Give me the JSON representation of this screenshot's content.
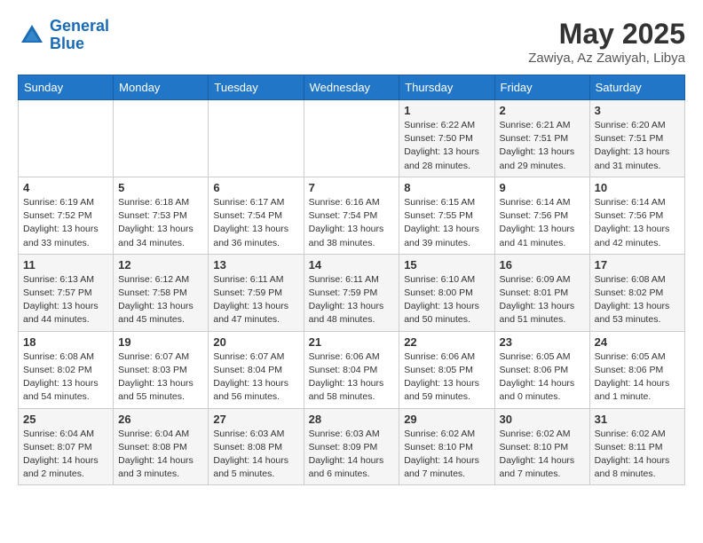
{
  "header": {
    "logo_line1": "General",
    "logo_line2": "Blue",
    "month_title": "May 2025",
    "location": "Zawiya, Az Zawiyah, Libya"
  },
  "weekdays": [
    "Sunday",
    "Monday",
    "Tuesday",
    "Wednesday",
    "Thursday",
    "Friday",
    "Saturday"
  ],
  "weeks": [
    [
      {
        "day": "",
        "info": ""
      },
      {
        "day": "",
        "info": ""
      },
      {
        "day": "",
        "info": ""
      },
      {
        "day": "",
        "info": ""
      },
      {
        "day": "1",
        "info": "Sunrise: 6:22 AM\nSunset: 7:50 PM\nDaylight: 13 hours\nand 28 minutes."
      },
      {
        "day": "2",
        "info": "Sunrise: 6:21 AM\nSunset: 7:51 PM\nDaylight: 13 hours\nand 29 minutes."
      },
      {
        "day": "3",
        "info": "Sunrise: 6:20 AM\nSunset: 7:51 PM\nDaylight: 13 hours\nand 31 minutes."
      }
    ],
    [
      {
        "day": "4",
        "info": "Sunrise: 6:19 AM\nSunset: 7:52 PM\nDaylight: 13 hours\nand 33 minutes."
      },
      {
        "day": "5",
        "info": "Sunrise: 6:18 AM\nSunset: 7:53 PM\nDaylight: 13 hours\nand 34 minutes."
      },
      {
        "day": "6",
        "info": "Sunrise: 6:17 AM\nSunset: 7:54 PM\nDaylight: 13 hours\nand 36 minutes."
      },
      {
        "day": "7",
        "info": "Sunrise: 6:16 AM\nSunset: 7:54 PM\nDaylight: 13 hours\nand 38 minutes."
      },
      {
        "day": "8",
        "info": "Sunrise: 6:15 AM\nSunset: 7:55 PM\nDaylight: 13 hours\nand 39 minutes."
      },
      {
        "day": "9",
        "info": "Sunrise: 6:14 AM\nSunset: 7:56 PM\nDaylight: 13 hours\nand 41 minutes."
      },
      {
        "day": "10",
        "info": "Sunrise: 6:14 AM\nSunset: 7:56 PM\nDaylight: 13 hours\nand 42 minutes."
      }
    ],
    [
      {
        "day": "11",
        "info": "Sunrise: 6:13 AM\nSunset: 7:57 PM\nDaylight: 13 hours\nand 44 minutes."
      },
      {
        "day": "12",
        "info": "Sunrise: 6:12 AM\nSunset: 7:58 PM\nDaylight: 13 hours\nand 45 minutes."
      },
      {
        "day": "13",
        "info": "Sunrise: 6:11 AM\nSunset: 7:59 PM\nDaylight: 13 hours\nand 47 minutes."
      },
      {
        "day": "14",
        "info": "Sunrise: 6:11 AM\nSunset: 7:59 PM\nDaylight: 13 hours\nand 48 minutes."
      },
      {
        "day": "15",
        "info": "Sunrise: 6:10 AM\nSunset: 8:00 PM\nDaylight: 13 hours\nand 50 minutes."
      },
      {
        "day": "16",
        "info": "Sunrise: 6:09 AM\nSunset: 8:01 PM\nDaylight: 13 hours\nand 51 minutes."
      },
      {
        "day": "17",
        "info": "Sunrise: 6:08 AM\nSunset: 8:02 PM\nDaylight: 13 hours\nand 53 minutes."
      }
    ],
    [
      {
        "day": "18",
        "info": "Sunrise: 6:08 AM\nSunset: 8:02 PM\nDaylight: 13 hours\nand 54 minutes."
      },
      {
        "day": "19",
        "info": "Sunrise: 6:07 AM\nSunset: 8:03 PM\nDaylight: 13 hours\nand 55 minutes."
      },
      {
        "day": "20",
        "info": "Sunrise: 6:07 AM\nSunset: 8:04 PM\nDaylight: 13 hours\nand 56 minutes."
      },
      {
        "day": "21",
        "info": "Sunrise: 6:06 AM\nSunset: 8:04 PM\nDaylight: 13 hours\nand 58 minutes."
      },
      {
        "day": "22",
        "info": "Sunrise: 6:06 AM\nSunset: 8:05 PM\nDaylight: 13 hours\nand 59 minutes."
      },
      {
        "day": "23",
        "info": "Sunrise: 6:05 AM\nSunset: 8:06 PM\nDaylight: 14 hours\nand 0 minutes."
      },
      {
        "day": "24",
        "info": "Sunrise: 6:05 AM\nSunset: 8:06 PM\nDaylight: 14 hours\nand 1 minute."
      }
    ],
    [
      {
        "day": "25",
        "info": "Sunrise: 6:04 AM\nSunset: 8:07 PM\nDaylight: 14 hours\nand 2 minutes."
      },
      {
        "day": "26",
        "info": "Sunrise: 6:04 AM\nSunset: 8:08 PM\nDaylight: 14 hours\nand 3 minutes."
      },
      {
        "day": "27",
        "info": "Sunrise: 6:03 AM\nSunset: 8:08 PM\nDaylight: 14 hours\nand 5 minutes."
      },
      {
        "day": "28",
        "info": "Sunrise: 6:03 AM\nSunset: 8:09 PM\nDaylight: 14 hours\nand 6 minutes."
      },
      {
        "day": "29",
        "info": "Sunrise: 6:02 AM\nSunset: 8:10 PM\nDaylight: 14 hours\nand 7 minutes."
      },
      {
        "day": "30",
        "info": "Sunrise: 6:02 AM\nSunset: 8:10 PM\nDaylight: 14 hours\nand 7 minutes."
      },
      {
        "day": "31",
        "info": "Sunrise: 6:02 AM\nSunset: 8:11 PM\nDaylight: 14 hours\nand 8 minutes."
      }
    ]
  ]
}
